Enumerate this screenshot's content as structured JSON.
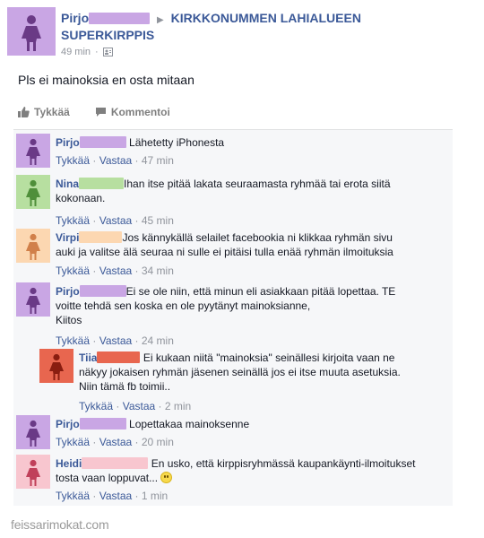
{
  "post": {
    "author": "Pirjo",
    "arrow": "▶",
    "group_line1": "KIRKKONUMMEN LAHIALUEEN",
    "group_line2": "SUPERKIRPPIS",
    "time": "49 min",
    "dot": "·",
    "text": "Pls ei mainoksia en osta mitaan",
    "like_label": "Tykkää",
    "comment_label": "Kommentoi"
  },
  "comments": [
    {
      "name": "Pirjo",
      "text": "Lähetetty iPhonesta",
      "like": "Tykkää",
      "sep": "·",
      "reply": "Vastaa",
      "time": "47 min"
    },
    {
      "name": "Nina",
      "text": "Ihan itse pitää lakata seuraamasta ryhmää tai erota siitä kokonaan.",
      "like": "Tykkää",
      "sep": "·",
      "reply": "Vastaa",
      "time": "45 min"
    },
    {
      "name": "Virpi",
      "text": "Jos kännykällä selailet facebookia ni klikkaa ryhmän sivu auki ja valitse älä seuraa ni sulle ei pitäisi tulla enää ryhmän ilmoituksia",
      "like": "Tykkää",
      "sep": "·",
      "reply": "Vastaa",
      "time": "34 min"
    },
    {
      "name": "Pirjo",
      "text": "Ei se ole niin, että minun eli asiakkaan pitää lopettaa. TE voitte tehdä sen koska en ole pyytänyt mainoksianne,",
      "text2": "Kiitos",
      "like": "Tykkää",
      "sep": "·",
      "reply": "Vastaa",
      "time": "24 min"
    },
    {
      "name": "Tiia",
      "text": "Ei kukaan niitä \"mainoksia\" seinällesi kirjoita vaan ne näkyy jokaisen ryhmän jäsenen seinällä jos ei itse muuta asetuksia. Niin tämä fb toimii..",
      "like": "Tykkää",
      "sep": "·",
      "reply": "Vastaa",
      "time": "2 min"
    },
    {
      "name": "Pirjo",
      "text": "Lopettakaa mainoksenne",
      "like": "Tykkää",
      "sep": "·",
      "reply": "Vastaa",
      "time": "20 min"
    },
    {
      "name": "Heidi",
      "text": "En usko, että kirppisryhmässä kaupankäynti-ilmoitukset tosta vaan loppuvat...",
      "like": "Tykkää",
      "sep": "·",
      "reply": "Vastaa",
      "time": "1 min"
    }
  ],
  "colors": {
    "link": "#3b5998",
    "pirjo": "#b39ddb",
    "pirjo_bg": "#c9a6e4",
    "nina": "#c5e1a5",
    "nina_bg": "#b7dfa0",
    "virpi": "#ffcc99",
    "virpi_bg": "#fcd7b1",
    "tiia": "#ef6c50",
    "tiia_bg": "#e8664f",
    "heidi": "#f8bbd0",
    "heidi_bg": "#f8c6cf"
  },
  "icons": [
    "person-silhouette-icon",
    "like-thumb-icon",
    "comment-bubble-icon",
    "audience-icon",
    "smiley-icon"
  ],
  "watermark": "feissarimokat.com"
}
